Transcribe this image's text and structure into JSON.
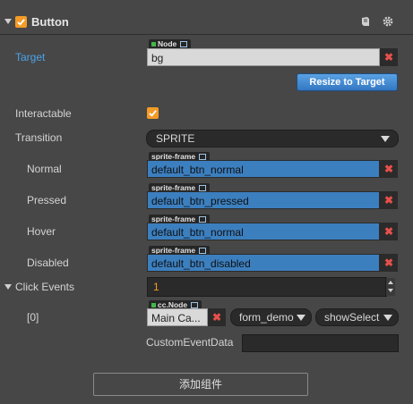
{
  "header": {
    "title": "Button",
    "enabled": true,
    "icons": [
      "book-icon",
      "gear-icon"
    ]
  },
  "target": {
    "label": "Target",
    "type_tag": "Node",
    "value": "bg",
    "resize_label": "Resize to Target"
  },
  "interactable": {
    "label": "Interactable",
    "checked": true
  },
  "transition": {
    "label": "Transition",
    "value": "SPRITE"
  },
  "states": [
    {
      "label": "Normal",
      "type_tag": "sprite-frame",
      "value": "default_btn_normal"
    },
    {
      "label": "Pressed",
      "type_tag": "sprite-frame",
      "value": "default_btn_pressed"
    },
    {
      "label": "Hover",
      "type_tag": "sprite-frame",
      "value": "default_btn_normal"
    },
    {
      "label": "Disabled",
      "type_tag": "sprite-frame",
      "value": "default_btn_disabled"
    }
  ],
  "click_events": {
    "label": "Click Events",
    "count": "1",
    "items": [
      {
        "index_label": "[0]",
        "type_tag": "cc.Node",
        "node_value": "Main Ca...",
        "component_value": "form_demo",
        "handler_value": "showSelect",
        "custom_data_label": "CustomEventData",
        "custom_data_value": ""
      }
    ]
  },
  "add_component_label": "添加组件",
  "colors": {
    "background": "#474747",
    "accent_orange": "#f39b26",
    "asset_blue": "#3c7fbf",
    "label_blue": "#4aa3e8",
    "clear_red": "#e8504a"
  }
}
